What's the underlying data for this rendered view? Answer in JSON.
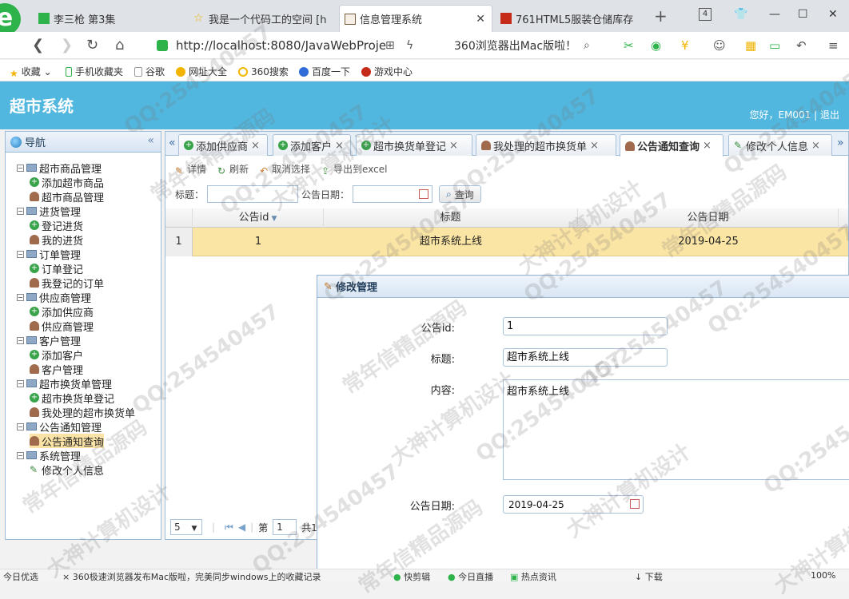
{
  "browser": {
    "tabs": [
      {
        "label": "李三枪 第3集",
        "icon_color": "#2db34a"
      },
      {
        "label": "我是一个代码工的空间 [h",
        "icon_color": "#f2b400"
      },
      {
        "label": "信息管理系统",
        "icon_color": "#7a5c3a",
        "active": true
      },
      {
        "label": "761HTML5服装仓储库存",
        "icon_color": "#c62b1a"
      }
    ],
    "tab_counter": "4",
    "url": "http://localhost:8080/JavaWebProje",
    "promo_text": "360浏览器出Mac版啦！",
    "bookmarks": [
      "收藏",
      "手机收藏夹",
      "谷歌",
      "网址大全",
      "360搜索",
      "百度一下",
      "游戏中心"
    ]
  },
  "app": {
    "title": "超市系统",
    "user_info": "您好，EM001 | 退出"
  },
  "west": {
    "title": "导航",
    "tree": [
      {
        "label": "超市商品管理",
        "type": "group"
      },
      {
        "label": "添加超市商品",
        "type": "add"
      },
      {
        "label": "超市商品管理",
        "type": "user"
      },
      {
        "label": "进货管理",
        "type": "group"
      },
      {
        "label": "登记进货",
        "type": "add"
      },
      {
        "label": "我的进货",
        "type": "user"
      },
      {
        "label": "订单管理",
        "type": "group"
      },
      {
        "label": "订单登记",
        "type": "add"
      },
      {
        "label": "我登记的订单",
        "type": "user"
      },
      {
        "label": "供应商管理",
        "type": "group"
      },
      {
        "label": "添加供应商",
        "type": "add"
      },
      {
        "label": "供应商管理",
        "type": "user"
      },
      {
        "label": "客户管理",
        "type": "group"
      },
      {
        "label": "添加客户",
        "type": "add"
      },
      {
        "label": "客户管理",
        "type": "user"
      },
      {
        "label": "超市换货单管理",
        "type": "group"
      },
      {
        "label": "超市换货单登记",
        "type": "add"
      },
      {
        "label": "我处理的超市换货单",
        "type": "user"
      },
      {
        "label": "公告通知管理",
        "type": "group"
      },
      {
        "label": "公告通知查询",
        "type": "user",
        "selected": true
      },
      {
        "label": "系统管理",
        "type": "group"
      },
      {
        "label": "修改个人信息",
        "type": "edit"
      }
    ]
  },
  "center": {
    "tabs": [
      "添加供应商",
      "添加客户",
      "超市换货单登记",
      "我处理的超市换货单",
      "公告通知查询",
      "修改个人信息"
    ],
    "active_tab": "公告通知查询",
    "toolbar": [
      "详情",
      "刷新",
      "取消选择",
      "导出到excel"
    ],
    "search": {
      "title_label": "标题：",
      "date_label": "公告日期：",
      "button": "查询"
    },
    "grid": {
      "columns": [
        "公告id",
        "标题",
        "公告日期"
      ],
      "rows": [
        {
          "num": "1",
          "id": "1",
          "title": "超市系统上线",
          "date": "2019-04-25"
        }
      ]
    },
    "pager": {
      "page_size": "5",
      "page_label": "第",
      "page_value": "1",
      "total_label": "共1"
    }
  },
  "dialog": {
    "title": "修改管理",
    "fields": {
      "id_label": "公告id:",
      "id_value": "1",
      "title_label": "标题:",
      "title_value": "超市系统上线",
      "content_label": "内容:",
      "content_value": "超市系统上线",
      "date_label": "公告日期:",
      "date_value": "2019-04-25"
    }
  },
  "statusbar": {
    "items": [
      "今日优选",
      "360极速浏览器发布Mac版啦，完美同步windows上的收藏记录",
      "快剪辑",
      "今日直播",
      "热点资讯",
      "下载",
      "100%"
    ]
  },
  "watermark": [
    "QQ:254540457",
    "常年信精品源码",
    "大神计算机设计"
  ]
}
